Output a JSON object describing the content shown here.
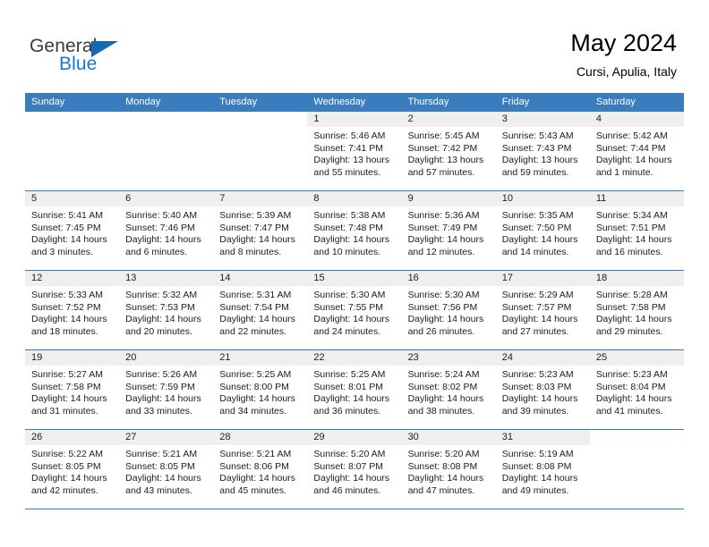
{
  "brand": {
    "name_part1": "General",
    "name_part2": "Blue",
    "triangle_color": "#1668b3",
    "blue_text_color": "#1b79c6"
  },
  "header": {
    "title": "May 2024",
    "subtitle": "Cursi, Apulia, Italy"
  },
  "theme": {
    "header_row_bg": "#3a7dbf",
    "day_head_bg": "#efefef",
    "grid_line": "#3a7dbf"
  },
  "weekdays": [
    "Sunday",
    "Monday",
    "Tuesday",
    "Wednesday",
    "Thursday",
    "Friday",
    "Saturday"
  ],
  "labels": {
    "sunrise": "Sunrise:",
    "sunset": "Sunset:",
    "daylight": "Daylight:"
  },
  "weeks": [
    [
      {
        "blank": true
      },
      {
        "blank": true
      },
      {
        "blank": true
      },
      {
        "date": "1",
        "sunrise": "Sunrise: 5:46 AM",
        "sunset": "Sunset: 7:41 PM",
        "daylight_1": "Daylight: 13 hours",
        "daylight_2": "and 55 minutes."
      },
      {
        "date": "2",
        "sunrise": "Sunrise: 5:45 AM",
        "sunset": "Sunset: 7:42 PM",
        "daylight_1": "Daylight: 13 hours",
        "daylight_2": "and 57 minutes."
      },
      {
        "date": "3",
        "sunrise": "Sunrise: 5:43 AM",
        "sunset": "Sunset: 7:43 PM",
        "daylight_1": "Daylight: 13 hours",
        "daylight_2": "and 59 minutes."
      },
      {
        "date": "4",
        "sunrise": "Sunrise: 5:42 AM",
        "sunset": "Sunset: 7:44 PM",
        "daylight_1": "Daylight: 14 hours",
        "daylight_2": "and 1 minute."
      }
    ],
    [
      {
        "date": "5",
        "sunrise": "Sunrise: 5:41 AM",
        "sunset": "Sunset: 7:45 PM",
        "daylight_1": "Daylight: 14 hours",
        "daylight_2": "and 3 minutes."
      },
      {
        "date": "6",
        "sunrise": "Sunrise: 5:40 AM",
        "sunset": "Sunset: 7:46 PM",
        "daylight_1": "Daylight: 14 hours",
        "daylight_2": "and 6 minutes."
      },
      {
        "date": "7",
        "sunrise": "Sunrise: 5:39 AM",
        "sunset": "Sunset: 7:47 PM",
        "daylight_1": "Daylight: 14 hours",
        "daylight_2": "and 8 minutes."
      },
      {
        "date": "8",
        "sunrise": "Sunrise: 5:38 AM",
        "sunset": "Sunset: 7:48 PM",
        "daylight_1": "Daylight: 14 hours",
        "daylight_2": "and 10 minutes."
      },
      {
        "date": "9",
        "sunrise": "Sunrise: 5:36 AM",
        "sunset": "Sunset: 7:49 PM",
        "daylight_1": "Daylight: 14 hours",
        "daylight_2": "and 12 minutes."
      },
      {
        "date": "10",
        "sunrise": "Sunrise: 5:35 AM",
        "sunset": "Sunset: 7:50 PM",
        "daylight_1": "Daylight: 14 hours",
        "daylight_2": "and 14 minutes."
      },
      {
        "date": "11",
        "sunrise": "Sunrise: 5:34 AM",
        "sunset": "Sunset: 7:51 PM",
        "daylight_1": "Daylight: 14 hours",
        "daylight_2": "and 16 minutes."
      }
    ],
    [
      {
        "date": "12",
        "sunrise": "Sunrise: 5:33 AM",
        "sunset": "Sunset: 7:52 PM",
        "daylight_1": "Daylight: 14 hours",
        "daylight_2": "and 18 minutes."
      },
      {
        "date": "13",
        "sunrise": "Sunrise: 5:32 AM",
        "sunset": "Sunset: 7:53 PM",
        "daylight_1": "Daylight: 14 hours",
        "daylight_2": "and 20 minutes."
      },
      {
        "date": "14",
        "sunrise": "Sunrise: 5:31 AM",
        "sunset": "Sunset: 7:54 PM",
        "daylight_1": "Daylight: 14 hours",
        "daylight_2": "and 22 minutes."
      },
      {
        "date": "15",
        "sunrise": "Sunrise: 5:30 AM",
        "sunset": "Sunset: 7:55 PM",
        "daylight_1": "Daylight: 14 hours",
        "daylight_2": "and 24 minutes."
      },
      {
        "date": "16",
        "sunrise": "Sunrise: 5:30 AM",
        "sunset": "Sunset: 7:56 PM",
        "daylight_1": "Daylight: 14 hours",
        "daylight_2": "and 26 minutes."
      },
      {
        "date": "17",
        "sunrise": "Sunrise: 5:29 AM",
        "sunset": "Sunset: 7:57 PM",
        "daylight_1": "Daylight: 14 hours",
        "daylight_2": "and 27 minutes."
      },
      {
        "date": "18",
        "sunrise": "Sunrise: 5:28 AM",
        "sunset": "Sunset: 7:58 PM",
        "daylight_1": "Daylight: 14 hours",
        "daylight_2": "and 29 minutes."
      }
    ],
    [
      {
        "date": "19",
        "sunrise": "Sunrise: 5:27 AM",
        "sunset": "Sunset: 7:58 PM",
        "daylight_1": "Daylight: 14 hours",
        "daylight_2": "and 31 minutes."
      },
      {
        "date": "20",
        "sunrise": "Sunrise: 5:26 AM",
        "sunset": "Sunset: 7:59 PM",
        "daylight_1": "Daylight: 14 hours",
        "daylight_2": "and 33 minutes."
      },
      {
        "date": "21",
        "sunrise": "Sunrise: 5:25 AM",
        "sunset": "Sunset: 8:00 PM",
        "daylight_1": "Daylight: 14 hours",
        "daylight_2": "and 34 minutes."
      },
      {
        "date": "22",
        "sunrise": "Sunrise: 5:25 AM",
        "sunset": "Sunset: 8:01 PM",
        "daylight_1": "Daylight: 14 hours",
        "daylight_2": "and 36 minutes."
      },
      {
        "date": "23",
        "sunrise": "Sunrise: 5:24 AM",
        "sunset": "Sunset: 8:02 PM",
        "daylight_1": "Daylight: 14 hours",
        "daylight_2": "and 38 minutes."
      },
      {
        "date": "24",
        "sunrise": "Sunrise: 5:23 AM",
        "sunset": "Sunset: 8:03 PM",
        "daylight_1": "Daylight: 14 hours",
        "daylight_2": "and 39 minutes."
      },
      {
        "date": "25",
        "sunrise": "Sunrise: 5:23 AM",
        "sunset": "Sunset: 8:04 PM",
        "daylight_1": "Daylight: 14 hours",
        "daylight_2": "and 41 minutes."
      }
    ],
    [
      {
        "date": "26",
        "sunrise": "Sunrise: 5:22 AM",
        "sunset": "Sunset: 8:05 PM",
        "daylight_1": "Daylight: 14 hours",
        "daylight_2": "and 42 minutes."
      },
      {
        "date": "27",
        "sunrise": "Sunrise: 5:21 AM",
        "sunset": "Sunset: 8:05 PM",
        "daylight_1": "Daylight: 14 hours",
        "daylight_2": "and 43 minutes."
      },
      {
        "date": "28",
        "sunrise": "Sunrise: 5:21 AM",
        "sunset": "Sunset: 8:06 PM",
        "daylight_1": "Daylight: 14 hours",
        "daylight_2": "and 45 minutes."
      },
      {
        "date": "29",
        "sunrise": "Sunrise: 5:20 AM",
        "sunset": "Sunset: 8:07 PM",
        "daylight_1": "Daylight: 14 hours",
        "daylight_2": "and 46 minutes."
      },
      {
        "date": "30",
        "sunrise": "Sunrise: 5:20 AM",
        "sunset": "Sunset: 8:08 PM",
        "daylight_1": "Daylight: 14 hours",
        "daylight_2": "and 47 minutes."
      },
      {
        "date": "31",
        "sunrise": "Sunrise: 5:19 AM",
        "sunset": "Sunset: 8:08 PM",
        "daylight_1": "Daylight: 14 hours",
        "daylight_2": "and 49 minutes."
      },
      {
        "blank": true
      }
    ]
  ]
}
